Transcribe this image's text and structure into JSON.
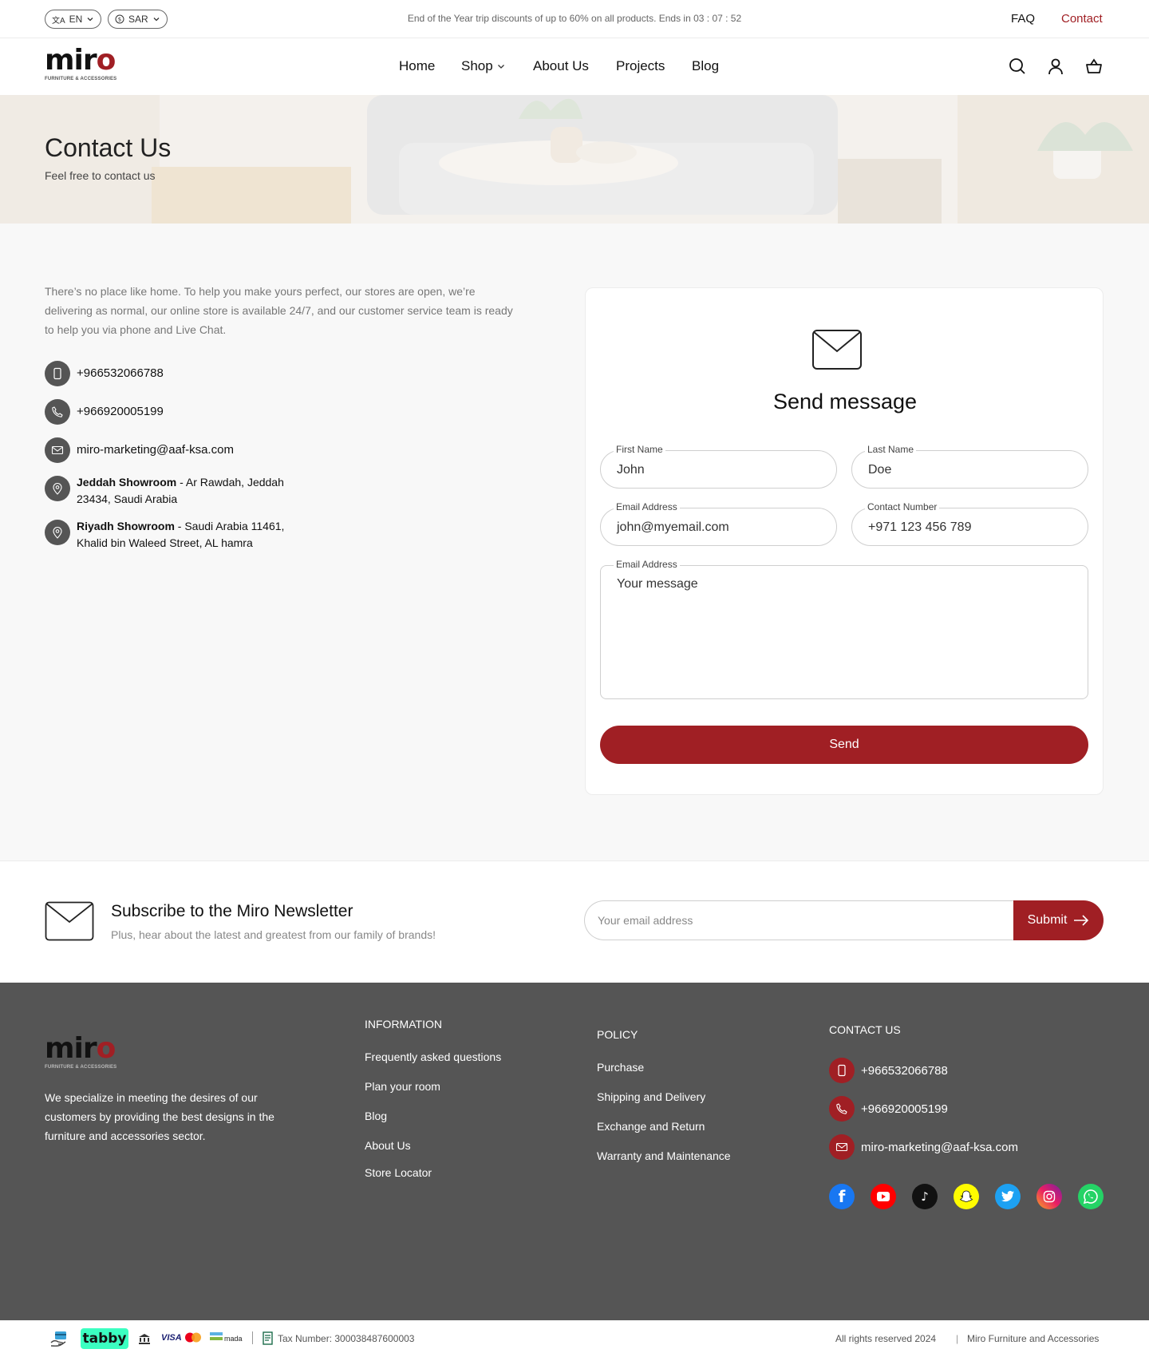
{
  "topbar": {
    "language": "EN",
    "currency": "SAR",
    "announcement": "End of the Year trip discounts of up to 60% on all products. Ends in 03 : 07 : 52",
    "faq_label": "FAQ",
    "contact_label": "Contact"
  },
  "brand": {
    "logo_word": "miro",
    "logo_sub": "FURNITURE & ACCESSORIES",
    "accent_color": "#a01f24"
  },
  "nav": {
    "items": [
      {
        "label": "Home"
      },
      {
        "label": "Shop"
      },
      {
        "label": "About Us"
      },
      {
        "label": "Projects"
      },
      {
        "label": "Blog"
      }
    ],
    "icons": [
      "search-icon",
      "user-icon",
      "cart-icon"
    ]
  },
  "hero": {
    "title": "Contact Us",
    "subtitle": "Feel free to contact us"
  },
  "contact": {
    "intro": "There’s no place like home. To help you make yours perfect, our stores are open, we’re delivering as normal, our online store is available 24/7, and our customer service team is ready to help you via phone and Live Chat.",
    "mobile": "+966532066788",
    "phone": "+966920005199",
    "email": "miro-marketing@aaf-ksa.com",
    "showrooms": [
      {
        "name": "Jeddah Showroom",
        "address_line1": " - Ar Rawdah, Jeddah",
        "address_line2": "23434, Saudi Arabia"
      },
      {
        "name": "Riyadh Showroom",
        "address_line1": " - Saudi Arabia 11461,",
        "address_line2": "Khalid bin Waleed Street, AL hamra"
      }
    ]
  },
  "form": {
    "title": "Send message",
    "first_name": {
      "label": "First Name",
      "placeholder": "John"
    },
    "last_name": {
      "label": "Last Name",
      "placeholder": "Doe"
    },
    "email": {
      "label": "Email Address",
      "placeholder": "john@myemail.com"
    },
    "contact_number": {
      "label": "Contact Number",
      "placeholder": "+971 123 456 789"
    },
    "message": {
      "label": "Email Address",
      "placeholder": "Your message"
    },
    "send_label": "Send"
  },
  "newsletter": {
    "title": "Subscribe to the Miro Newsletter",
    "subtitle": "Plus, hear about the latest and greatest from our family of brands!",
    "placeholder": "Your email address",
    "submit_label": "Submit"
  },
  "footer": {
    "description": "We specialize in meeting the desires of our customers by providing the best designs in the furniture and accessories sector.",
    "information": {
      "heading": "INFORMATION",
      "links": [
        "Frequently asked questions",
        "Plan your room",
        "Blog",
        "About Us",
        "Store Locator"
      ]
    },
    "policy": {
      "heading": "POLICY",
      "links": [
        "Purchase",
        "Shipping and Delivery",
        "Exchange and Return",
        "Warranty and Maintenance"
      ]
    },
    "contact": {
      "heading": "CONTACT US",
      "mobile": "+966532066788",
      "phone": "+966920005199",
      "email": "miro-marketing@aaf-ksa.com"
    },
    "social": [
      {
        "name": "facebook-icon",
        "color": "#1877f2"
      },
      {
        "name": "youtube-icon",
        "color": "#ff0000"
      },
      {
        "name": "tiktok-icon",
        "color": "#111111"
      },
      {
        "name": "snapchat-icon",
        "color": "#fffc00"
      },
      {
        "name": "twitter-icon",
        "color": "#1da1f2"
      },
      {
        "name": "instagram-icon",
        "color": "#d6249f"
      },
      {
        "name": "whatsapp-icon",
        "color": "#25d366"
      }
    ]
  },
  "bottom": {
    "payment_tabby": "tabby",
    "payment_visa": "VISA",
    "payment_mada": "mada",
    "tax_number": "Tax Number: 300038487600003",
    "rights": "All rights reserved 2024",
    "company": "Miro Furniture and Accessories"
  }
}
